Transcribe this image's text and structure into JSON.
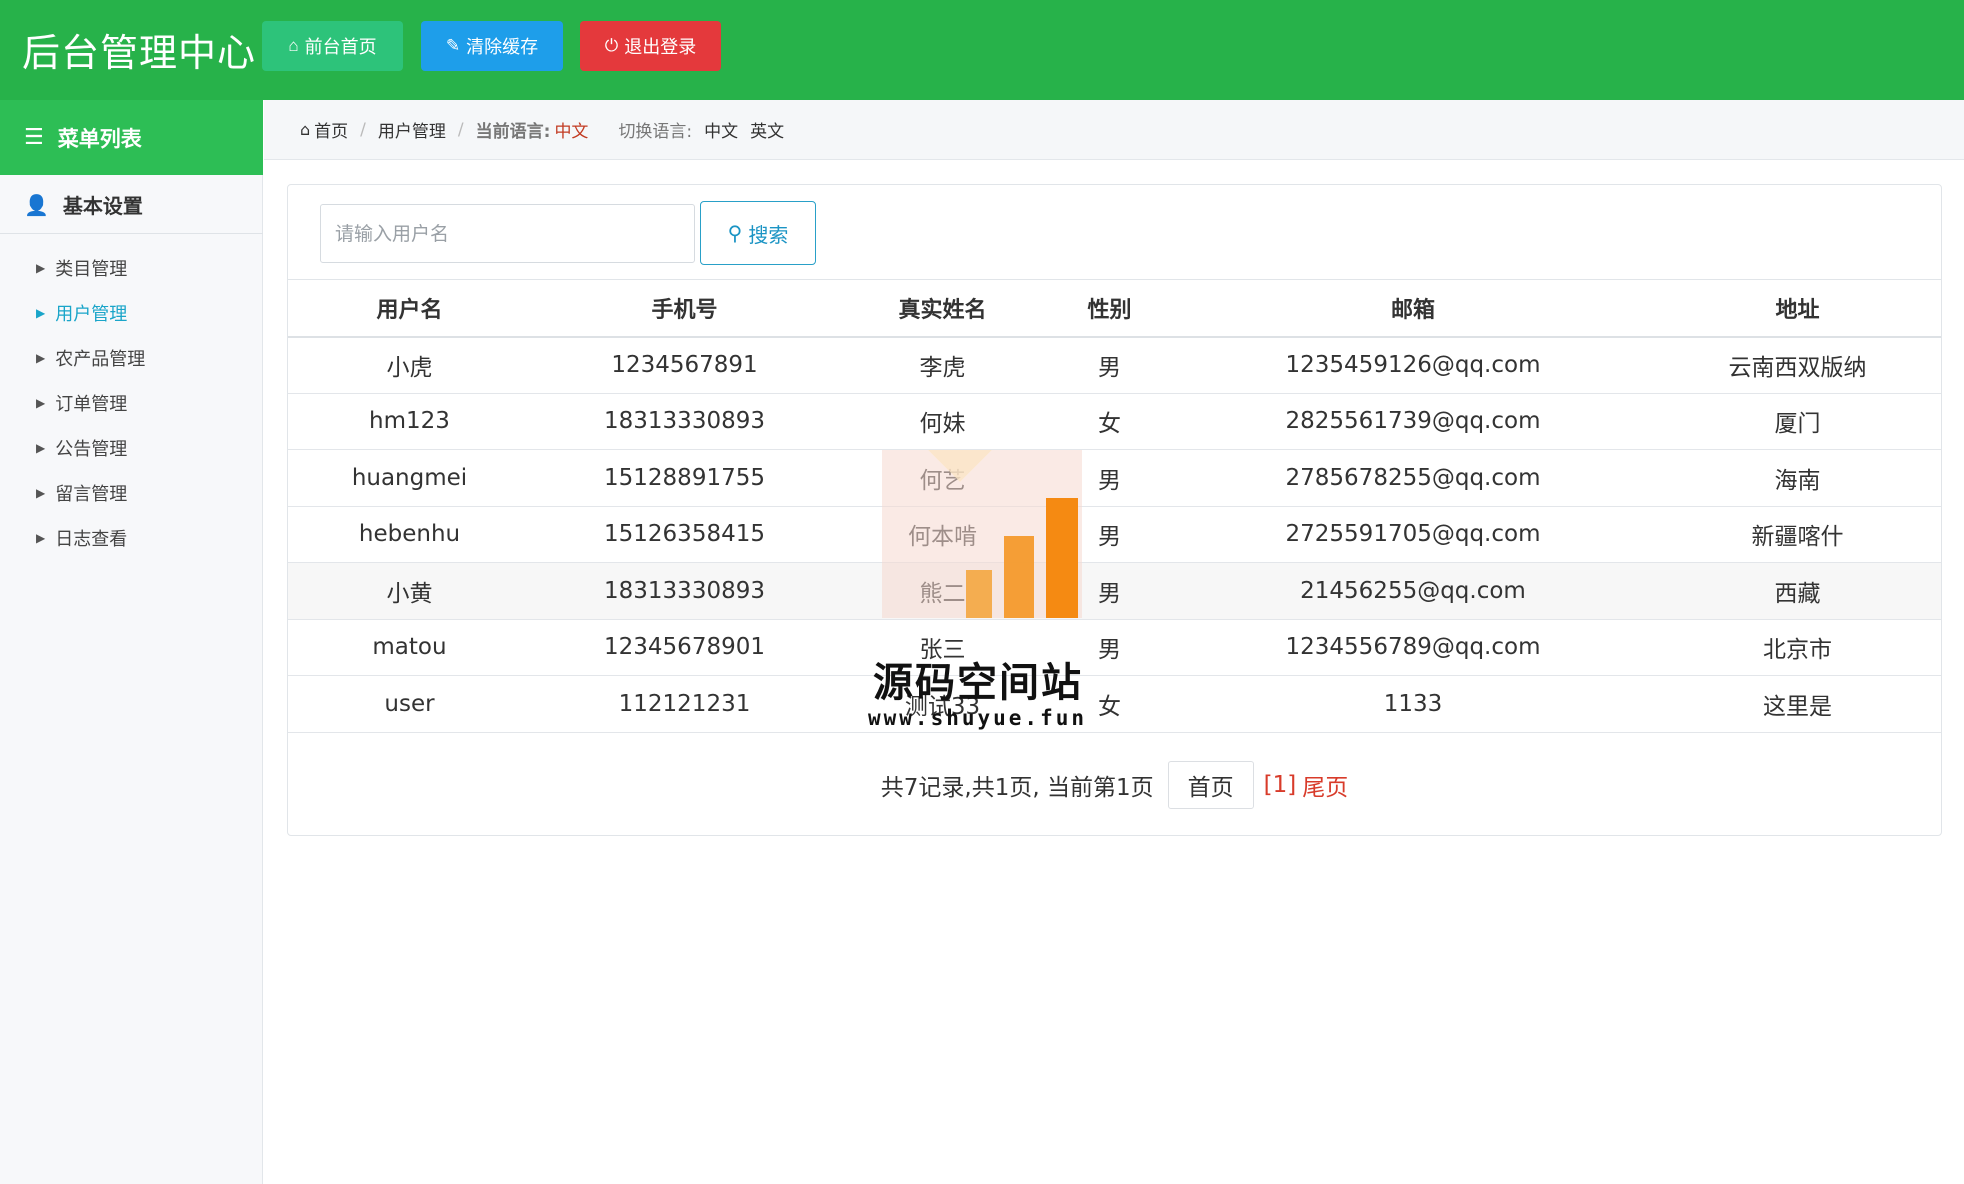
{
  "header": {
    "brand": "后台管理中心",
    "home_btn": "前台首页",
    "cache_btn": "清除缓存",
    "logout_btn": "退出登录"
  },
  "sidebar": {
    "menu_title": "菜单列表",
    "group_title": "基本设置",
    "items": [
      {
        "label": "类目管理"
      },
      {
        "label": "用户管理"
      },
      {
        "label": "农产品管理"
      },
      {
        "label": "订单管理"
      },
      {
        "label": "公告管理"
      },
      {
        "label": "留言管理"
      },
      {
        "label": "日志查看"
      }
    ]
  },
  "breadcrumb": {
    "home": "首页",
    "current": "用户管理",
    "lang_label": "当前语言:",
    "lang_value": "中文",
    "switch_label": "切换语言:",
    "lang_zh": "中文",
    "lang_en": "英文"
  },
  "search": {
    "placeholder": "请输入用户名",
    "button": "搜索"
  },
  "table": {
    "headers": [
      "用户名",
      "手机号",
      "真实姓名",
      "性别",
      "邮箱",
      "地址"
    ],
    "rows": [
      [
        "小虎",
        "1234567891",
        "李虎",
        "男",
        "1235459126@qq.com",
        "云南西双版纳"
      ],
      [
        "hm123",
        "18313330893",
        "何妹",
        "女",
        "2825561739@qq.com",
        "厦门"
      ],
      [
        "huangmei",
        "15128891755",
        "何艺",
        "男",
        "2785678255@qq.com",
        "海南"
      ],
      [
        "hebenhu",
        "15126358415",
        "何本啃",
        "男",
        "2725591705@qq.com",
        "新疆喀什"
      ],
      [
        "小黄",
        "18313330893",
        "熊二",
        "男",
        "21456255@qq.com",
        "西藏"
      ],
      [
        "matou",
        "12345678901",
        "张三",
        "男",
        "1234556789@qq.com",
        "北京市"
      ],
      [
        "user",
        "112121231",
        "测试33",
        "女",
        "1133",
        "这里是"
      ]
    ]
  },
  "pager": {
    "summary": "共7记录,共1页, 当前第1页",
    "first": "首页",
    "current": "[1]",
    "last": "尾页"
  },
  "watermark": {
    "title": "源码空间站",
    "url": "www.shuyue.fun"
  },
  "colors": {
    "header_bg": "#27b24a",
    "menu_head_bg": "#2dbe55",
    "home_btn": "#2dc37a",
    "cache_btn": "#1e9eea",
    "logout_btn": "#e4393c",
    "active_link": "#1aa5c9",
    "pager_red": "#d83b2a"
  },
  "icons": {
    "home": "home-icon",
    "cache": "wrench-icon",
    "logout": "power-icon",
    "menu": "list-icon",
    "group": "user-icon",
    "caret": "caret-right-icon",
    "search": "search-icon"
  }
}
